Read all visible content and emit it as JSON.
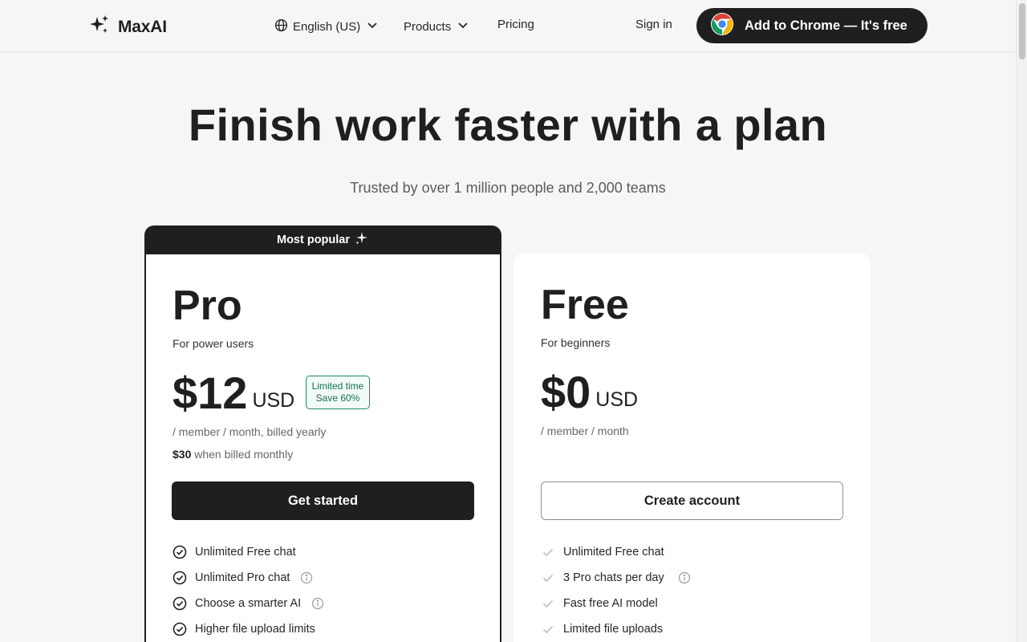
{
  "header": {
    "logo_text": "MaxAI",
    "nav": {
      "language": "English (US)",
      "products": "Products",
      "pricing": "Pricing"
    },
    "sign_in": "Sign in",
    "cta": "Add to Chrome — It's free"
  },
  "hero": {
    "title": "Finish work faster with a plan",
    "subtitle": "Trusted by over 1 million people and 2,000 teams"
  },
  "plans": {
    "pro": {
      "badge_top": "Most popular",
      "name": "Pro",
      "description": "For power users",
      "price": "$12",
      "currency": "USD",
      "promo_line1": "Limited time",
      "promo_line2": "Save 60%",
      "billing": "/ member / month, billed yearly",
      "monthly_price": "$30",
      "monthly_text": "when billed monthly",
      "button": "Get started",
      "features": [
        "Unlimited Free chat",
        "Unlimited Pro chat",
        "Choose a smarter AI",
        "Higher file upload limits"
      ]
    },
    "free": {
      "name": "Free",
      "description": "For beginners",
      "price": "$0",
      "currency": "USD",
      "billing": "/ member / month",
      "button": "Create account",
      "features": [
        "Unlimited Free chat",
        "3 Pro chats per day",
        "Fast free AI model",
        "Limited file uploads"
      ]
    }
  },
  "colors": {
    "background": "#f6f6f6",
    "dark": "#1f1f1f",
    "promo_green": "#15714f"
  },
  "icons": [
    "sparkle-logo-icon",
    "globe-icon",
    "chevron-down-icon",
    "chrome-logo-icon",
    "sparkle-icon",
    "check-circle-icon",
    "check-icon",
    "info-icon"
  ]
}
